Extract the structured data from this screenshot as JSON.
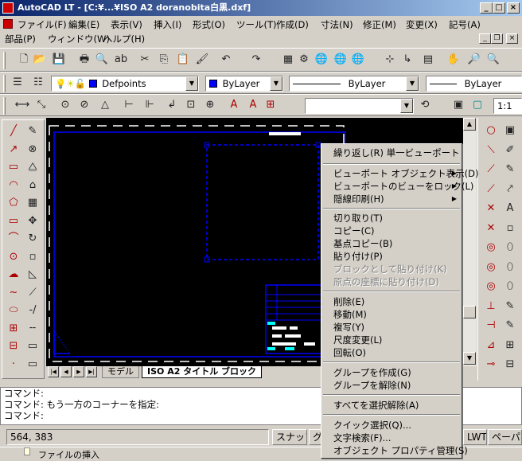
{
  "window": {
    "title": "AutoCAD LT - [C:¥...¥ISO A2 doranobita白黒.dxf]"
  },
  "caption_buttons": {
    "minimize": "_",
    "maximize": "□",
    "close": "×"
  },
  "menu": {
    "row1": [
      "ファイル(F)",
      "編集(E)",
      "表示(V)",
      "挿入(I)",
      "形式(O)",
      "ツール(T)",
      "作成(D)",
      "寸法(N)",
      "修正(M)",
      "変更(X)",
      "記号(A)"
    ],
    "row2": [
      "部品(P)",
      "ウィンドウ(W)",
      "ヘルプ(H)"
    ]
  },
  "properties_bar": {
    "layer": "Defpoints",
    "color": "ByLayer",
    "linetype": "ByLayer",
    "lineweight": "ByLayer",
    "swatch_color": "#0000ff"
  },
  "dim_bar": {
    "scale": "1:1"
  },
  "layout_tabs": {
    "model": "モデル",
    "layout": "ISO A2 タイトル ブロック"
  },
  "command_line": {
    "lines": [
      "コマンド:",
      "コマンド: もう一方のコーナーを指定:",
      "コマンド:"
    ]
  },
  "status_bar": {
    "coords": "564, 383",
    "snap": "スナップ",
    "grid": "グ",
    "lwt": "LWT",
    "paper": "ペーパ"
  },
  "taskbar": {
    "item": "ファイルの挿入"
  },
  "context_menu": {
    "items": [
      {
        "label": "繰り返し(R) 単一ビューポート",
        "enabled": true,
        "submenu": false
      },
      {
        "label": "ビューポート オブジェクト表示(D)",
        "enabled": true,
        "submenu": true
      },
      {
        "label": "ビューポートのビューをロック(L)",
        "enabled": true,
        "submenu": true
      },
      {
        "label": "隠線印刷(H)",
        "enabled": true,
        "submenu": true
      },
      {
        "label": "切り取り(T)",
        "enabled": true,
        "submenu": false
      },
      {
        "label": "コピー(C)",
        "enabled": true,
        "submenu": false
      },
      {
        "label": "基点コピー(B)",
        "enabled": true,
        "submenu": false
      },
      {
        "label": "貼り付け(P)",
        "enabled": true,
        "submenu": false
      },
      {
        "label": "ブロックとして貼り付け(K)",
        "enabled": false,
        "submenu": false
      },
      {
        "label": "原点の座標に貼り付け(D)",
        "enabled": false,
        "submenu": false
      },
      {
        "label": "削除(E)",
        "enabled": true,
        "submenu": false
      },
      {
        "label": "移動(M)",
        "enabled": true,
        "submenu": false
      },
      {
        "label": "複写(Y)",
        "enabled": true,
        "submenu": false
      },
      {
        "label": "尺度変更(L)",
        "enabled": true,
        "submenu": false
      },
      {
        "label": "回転(O)",
        "enabled": true,
        "submenu": false
      },
      {
        "label": "グループを作成(G)",
        "enabled": true,
        "submenu": false
      },
      {
        "label": "グループを解除(N)",
        "enabled": true,
        "submenu": false
      },
      {
        "label": "すべてを選択解除(A)",
        "enabled": true,
        "submenu": false
      },
      {
        "label": "クイック選択(Q)...",
        "enabled": true,
        "submenu": false
      },
      {
        "label": "文字検索(F)...",
        "enabled": true,
        "submenu": false
      },
      {
        "label": "オブジェクト プロパティ管理(S)",
        "enabled": true,
        "submenu": false
      }
    ]
  },
  "icons": {
    "std_toolbar": [
      "new-icon",
      "open-icon",
      "save-icon",
      "print-icon",
      "preview-icon",
      "spell-icon",
      "cut-icon",
      "copy-icon",
      "paste-icon",
      "match-prop-icon",
      "undo-icon",
      "redo-icon",
      "design-center-icon",
      "properties-icon",
      "web-icon",
      "web2-icon",
      "web3-icon",
      "snap-icon",
      "ucs-icon",
      "layer-icon",
      "pan-icon",
      "zoom-realtime-icon",
      "zoom-window-icon"
    ]
  },
  "colors": {
    "titlebar": "#0a246a",
    "canvas": "#000000",
    "entity": "#0000ff"
  }
}
